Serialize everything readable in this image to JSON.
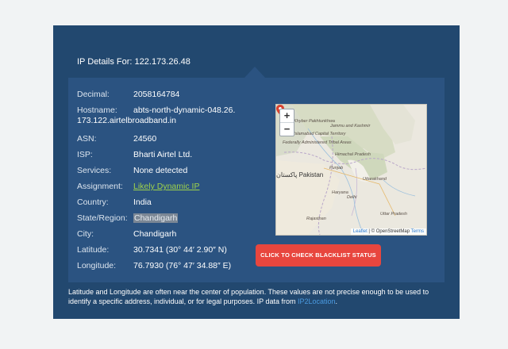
{
  "header": {
    "title": "IP Details For: 122.173.26.48"
  },
  "details": [
    {
      "label": "Decimal:",
      "value": "2058164784"
    },
    {
      "label": "Hostname:",
      "value": "abts-north-dynamic-048.26.173.122.airtelbroadband.in"
    },
    {
      "label": "ASN:",
      "value": "24560"
    },
    {
      "label": "ISP:",
      "value": "Bharti Airtel Ltd."
    },
    {
      "label": "Services:",
      "value": "None detected"
    },
    {
      "label": "Assignment:",
      "value": "Likely Dynamic IP"
    },
    {
      "label": "Country:",
      "value": "India"
    },
    {
      "label": "State/Region:",
      "value": "Chandigarh"
    },
    {
      "label": "City:",
      "value": "Chandigarh"
    },
    {
      "label": "Latitude:",
      "value": "30.7341 (30° 44′ 2.90″ N)"
    },
    {
      "label": "Longitude:",
      "value": "76.7930 (76° 47′ 34.88″ E)"
    }
  ],
  "map": {
    "zoom_in": "+",
    "zoom_out": "−",
    "labels": {
      "khunkhwa": "Khyber Pakhtunkhwa",
      "islamabad": "Islamabad Capital Territory",
      "fata": "Federally Administered Tribal Areas",
      "jk": "Jammu and Kashmir",
      "hp": "Himachal Pradesh",
      "punjab": "Punjab",
      "uttarakhand": "Uttarakhand",
      "pakistan": "پاکستان Pakistan",
      "haryana": "Haryana",
      "delhi": "Delhi",
      "rajasthan": "Rajasthan",
      "up": "Uttar Pradesh"
    },
    "attribution_leaflet": "Leaflet",
    "attribution_sep": " | © OpenStreetMap ",
    "attribution_terms": "Terms"
  },
  "blacklist_button": "CLICK TO CHECK BLACKLIST STATUS",
  "note": {
    "text": "Latitude and Longitude are often near the center of population. These values are not precise enough to be used to identify a specific address, individual, or for legal purposes. IP data from ",
    "link": "IP2Location",
    "end": "."
  },
  "colors": {
    "panel": "#22486f",
    "card": "#2b5381",
    "button": "#e8463e",
    "link_green": "#9fd34a",
    "link_blue": "#4a9ae0"
  }
}
